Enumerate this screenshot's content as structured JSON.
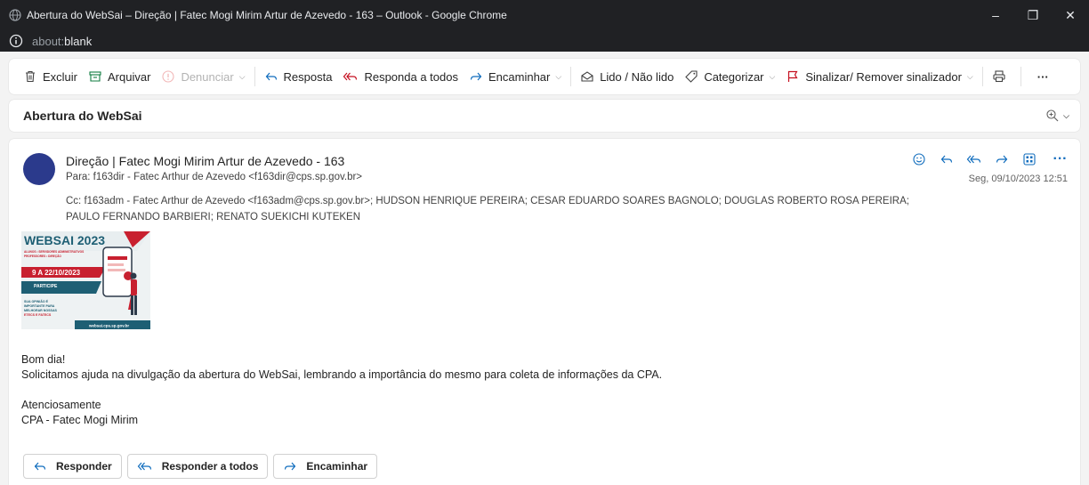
{
  "window": {
    "title": "Abertura do WebSai – Direção | Fatec Mogi Mirim Artur de Azevedo - 163 – Outlook - Google Chrome",
    "controls": {
      "minimize": "–",
      "restore": "❐",
      "close": "✕"
    }
  },
  "address": {
    "prefix": "about:",
    "host": "blank"
  },
  "toolbar": {
    "delete": "Excluir",
    "archive": "Arquivar",
    "report": "Denunciar",
    "reply": "Resposta",
    "reply_all": "Responda a todos",
    "forward": "Encaminhar",
    "read_unread": "Lido / Não lido",
    "categorize": "Categorizar",
    "flag": "Sinalizar/ Remover sinalizador",
    "more": "···"
  },
  "subject": "Abertura do WebSai",
  "message": {
    "sender": "Direção | Fatec Mogi Mirim Artur de Azevedo - 163",
    "to": "Para:  f163dir - Fatec Arthur de Azevedo <f163dir@cps.sp.gov.br>",
    "cc_line1": "Cc:  f163adm - Fatec Arthur de Azevedo <f163adm@cps.sp.gov.br>;   HUDSON HENRIQUE PEREIRA;   CESAR EDUARDO SOARES BAGNOLO;   DOUGLAS ROBERTO ROSA PEREIRA;",
    "cc_line2": "PAULO FERNANDO BARBIERI;   RENATO SUEKICHI KUTEKEN",
    "date": "Seg, 09/10/2023 12:51",
    "banner": {
      "title": "WEBSAI 2023",
      "subtitle": "ALUNOS • SERVIDORES ADMINISTRATIVOS\nPROFESSORES • DIREÇÃO",
      "dates": "9 A 22/10/2023",
      "cta": "PARTICIPE",
      "message": "SUA OPINIÃO É IMPORTANTE PARA MELHORAR NOSSAS ETECS E FATECS",
      "url": "websai.cps.sp.gov.br"
    },
    "body": [
      "Bom dia!",
      "Solicitamos ajuda na divulgação da abertura do WebSai, lembrando a importância do mesmo para coleta de informações da CPA.",
      "",
      "Atenciosamente",
      "CPA - Fatec Mogi Mirim"
    ],
    "buttons": {
      "reply": "Responder",
      "reply_all": "Responder a todos",
      "forward": "Encaminhar"
    }
  },
  "colors": {
    "accent": "#0f6cbd",
    "flag": "#c50f1f",
    "avatar": "#2b3a8c",
    "banner_red": "#c8202f",
    "banner_teal": "#1e5f74"
  }
}
